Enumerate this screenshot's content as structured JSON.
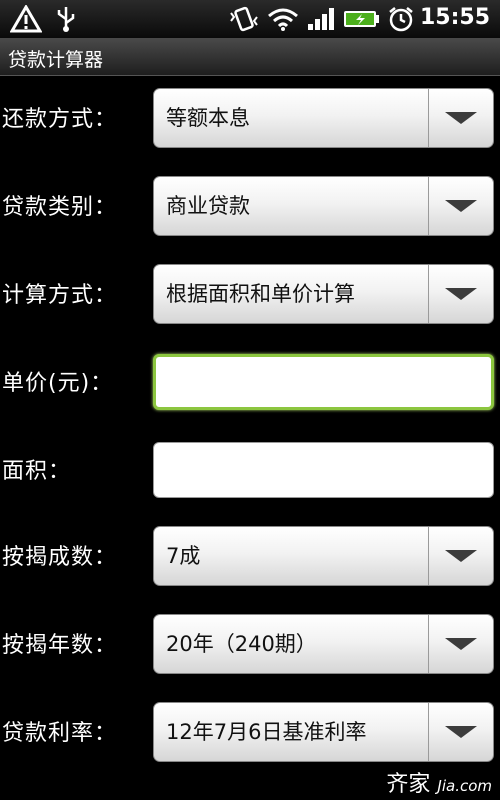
{
  "status_bar": {
    "time": "15:55",
    "icons": [
      "warning-icon",
      "usb-icon",
      "vibrate-icon",
      "wifi-icon",
      "signal-icon",
      "battery-charging-icon",
      "alarm-icon"
    ]
  },
  "app": {
    "title": "贷款计算器"
  },
  "form": {
    "repayment_method": {
      "label": "还款方式：",
      "value": "等额本息"
    },
    "loan_type": {
      "label": "贷款类别：",
      "value": "商业贷款"
    },
    "calc_method": {
      "label": "计算方式：",
      "value": "根据面积和单价计算"
    },
    "unit_price": {
      "label": "单价(元)：",
      "value": ""
    },
    "area": {
      "label": "面积：",
      "value": ""
    },
    "mortgage_ratio": {
      "label": "按揭成数：",
      "value": "7成"
    },
    "mortgage_years": {
      "label": "按揭年数：",
      "value": "20年（240期）"
    },
    "interest_rate": {
      "label": "贷款利率：",
      "value": "12年7月6日基准利率"
    }
  },
  "watermark": {
    "brand": "齐家",
    "domain": "Jia.com"
  },
  "colors": {
    "background": "#000000",
    "focus_border": "#8cc63f",
    "spinner_arrow": "#3c3c3c"
  }
}
